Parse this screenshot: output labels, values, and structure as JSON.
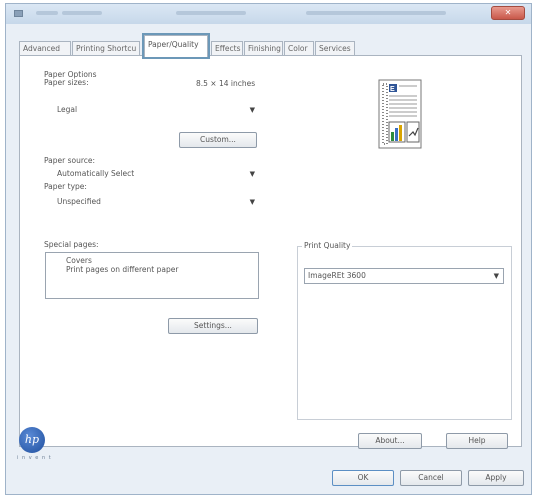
{
  "window": {
    "close_label": "✕"
  },
  "tabs": [
    {
      "label": "Advanced"
    },
    {
      "label": "Printing Shortcu"
    },
    {
      "label": "Paper/Quality"
    },
    {
      "label": "Effects"
    },
    {
      "label": "Finishing"
    },
    {
      "label": "Color"
    },
    {
      "label": "Services"
    }
  ],
  "paper_options": {
    "group_label": "Paper Options",
    "sizes_label": "Paper sizes:",
    "sizes_value": "8.5 × 14 inches",
    "size_select": "Legal",
    "custom_button": "Custom...",
    "source_label": "Paper source:",
    "source_select": "Automatically Select",
    "type_label": "Paper type:",
    "type_select": "Unspecified"
  },
  "special_pages": {
    "label": "Special pages:",
    "items": [
      "Covers",
      "Print pages on different paper"
    ],
    "settings_button": "Settings..."
  },
  "print_quality": {
    "group_label": "Print Quality",
    "select": "ImageREt 3600"
  },
  "footer": {
    "logo_text": "hp",
    "logo_subtext": "i n v e n t",
    "about_button": "About...",
    "help_button": "Help",
    "ok_button": "OK",
    "cancel_button": "Cancel",
    "apply_button": "Apply"
  },
  "colors": {
    "titlebar": "#c7d8ea",
    "tab_highlight": "#6c98b8",
    "close_button": "#c8584a"
  },
  "icons": [
    "document-preview-icon",
    "hp-logo-icon",
    "chevron-down-icon"
  ]
}
